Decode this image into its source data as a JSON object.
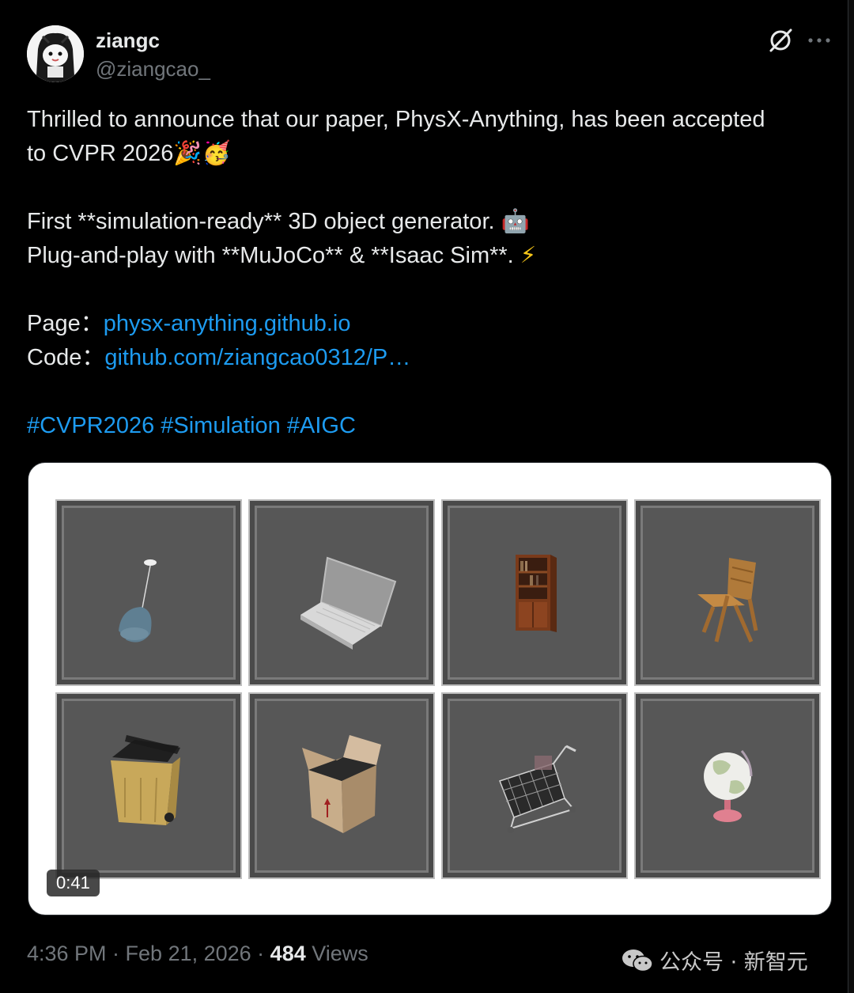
{
  "author": {
    "display_name": "ziangc",
    "handle": "@ziangcao_"
  },
  "header_icons": [
    "grok-icon",
    "more-icon"
  ],
  "tweet": {
    "line1": "Thrilled to announce that our paper, PhysX-Anything, has been accepted",
    "line2_text": "to CVPR 2026",
    "line2_emojis": "🎉🥳",
    "line3_text": "First **simulation-ready** 3D object generator.",
    "line3_emoji": "🤖",
    "line4_text": "Plug-and-play with **MuJoCo** & **Isaac Sim**.",
    "line4_emoji": "⚡",
    "page_label": "Page：",
    "page_link": "physx-anything.github.io",
    "code_label": "Code：",
    "code_link": "github.com/ziangcao0312/P…",
    "hashtags": "#CVPR2026 #Simulation #AIGC"
  },
  "media": {
    "duration": "0:41",
    "objects": [
      "hanging-lamp",
      "laptop",
      "bookshelf",
      "folding-chair",
      "trash-bin",
      "cardboard-box",
      "shopping-cart",
      "globe"
    ]
  },
  "meta": {
    "time_date": "4:36 PM · Feb 21, 2026 · ",
    "views_count": "484",
    "views_label": " Views"
  },
  "watermark": {
    "text": "公众号 · 新智元"
  },
  "colors": {
    "background": "#000000",
    "text": "#e7e9ea",
    "muted": "#71767b",
    "link": "#1d9bf0"
  }
}
